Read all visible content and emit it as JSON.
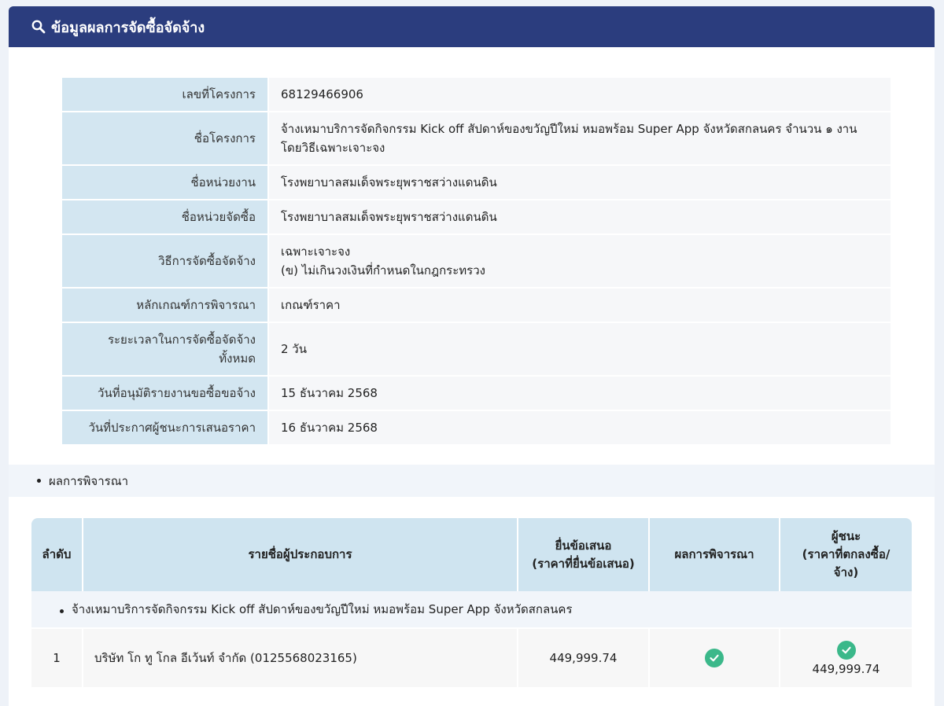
{
  "header": {
    "title": "ข้อมูลผลการจัดซื้อจัดจ้าง",
    "icon": "search-icon"
  },
  "info": [
    {
      "label": "เลขที่โครงการ",
      "value": [
        "68129466906"
      ]
    },
    {
      "label": "ชื่อโครงการ",
      "value": [
        "จ้างเหมาบริการจัดกิจกรรม Kick off สัปดาห์ของขวัญปีใหม่ หมอพร้อม Super App จังหวัดสกลนคร จำนวน ๑ งาน",
        "โดยวิธีเฉพาะเจาะจง"
      ]
    },
    {
      "label": "ชื่อหน่วยงาน",
      "value": [
        "โรงพยาบาลสมเด็จพระยุพราชสว่างแดนดิน"
      ]
    },
    {
      "label": "ชื่อหน่วยจัดซื้อ",
      "value": [
        "โรงพยาบาลสมเด็จพระยุพราชสว่างแดนดิน"
      ]
    },
    {
      "label": "วิธีการจัดซื้อจัดจ้าง",
      "value": [
        "เฉพาะเจาะจง",
        "(ข) ไม่เกินวงเงินที่กำหนดในกฎกระทรวง"
      ]
    },
    {
      "label": "หลักเกณฑ์การพิจารณา",
      "value": [
        "เกณฑ์ราคา"
      ]
    },
    {
      "label": "ระยะเวลาในการจัดซื้อจัดจ้าง ทั้งหมด",
      "value": [
        "2 วัน"
      ]
    },
    {
      "label": "วันที่อนุมัติรายงานขอซื้อขอจ้าง",
      "value": [
        "15 ธันวาคม 2568"
      ]
    },
    {
      "label": "วันที่ประกาศผู้ชนะการเสนอราคา",
      "value": [
        "16 ธันวาคม 2568"
      ]
    }
  ],
  "section": {
    "title": "ผลการพิจารณา"
  },
  "results": {
    "columns": {
      "order": "ลำดับ",
      "vendor": "รายชื่อผู้ประกอบการ",
      "bid_line1": "ยื่นข้อเสนอ",
      "bid_line2": "(ราคาที่ยื่นข้อเสนอ)",
      "result": "ผลการพิจารณา",
      "winner_line1": "ผู้ชนะ",
      "winner_line2": "(ราคาที่ตกลงซื้อ/",
      "winner_line3": "จ้าง)"
    },
    "group_title": "จ้างเหมาบริการจัดกิจกรรม Kick off สัปดาห์ของขวัญปีใหม่ หมอพร้อม Super App จังหวัดสกลนคร",
    "rows": [
      {
        "order": "1",
        "vendor": "บริษัท โก ทู โกล อีเว้นท์ จำกัด (0125568023165)",
        "bid": "449,999.74",
        "passed": true,
        "winner_price": "449,999.74"
      }
    ],
    "check_color": "#3bb88a"
  },
  "colors": {
    "header_bg": "#2b3d7e",
    "label_bg": "#d3e6f1",
    "table_header_bg": "#cfe4f0"
  }
}
